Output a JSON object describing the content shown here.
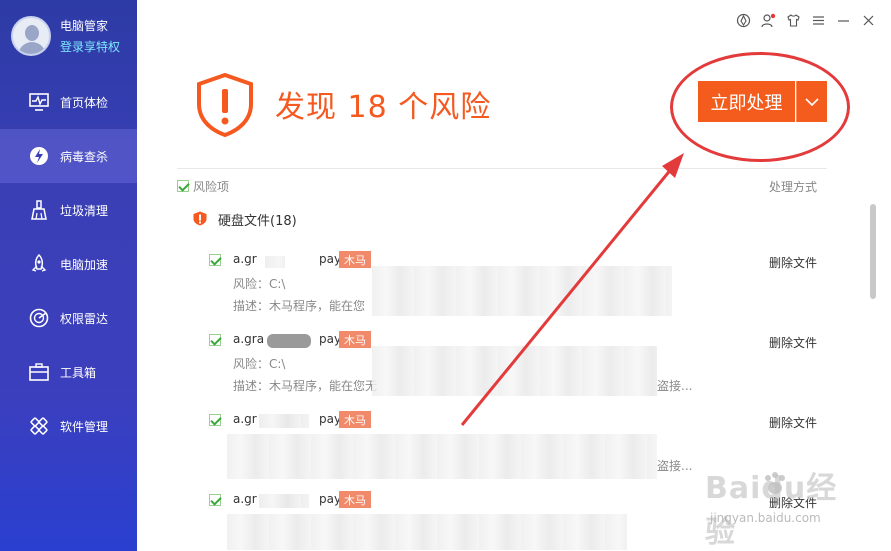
{
  "profile": {
    "name": "电脑管家",
    "login": "登录享特权"
  },
  "sidebar": {
    "items": [
      {
        "label": "首页体检",
        "icon": "monitor-icon",
        "active": false
      },
      {
        "label": "病毒查杀",
        "icon": "lightning-shield-icon",
        "active": true
      },
      {
        "label": "垃圾清理",
        "icon": "broom-icon",
        "active": false
      },
      {
        "label": "电脑加速",
        "icon": "rocket-icon",
        "active": false
      },
      {
        "label": "权限雷达",
        "icon": "radar-icon",
        "active": false
      },
      {
        "label": "工具箱",
        "icon": "toolbox-icon",
        "active": false
      },
      {
        "label": "软件管理",
        "icon": "apps-icon",
        "active": false
      }
    ]
  },
  "titlebar": {
    "icons": [
      "leaf-icon",
      "user-settings-icon",
      "shirt-icon",
      "menu-icon",
      "minimize-icon",
      "close-icon"
    ]
  },
  "header": {
    "headline": "发现 18 个风险",
    "action_label": "立即处理"
  },
  "list": {
    "col_left": "风险项",
    "col_right": "处理方式",
    "group_label": "硬盘文件(18)",
    "rows": [
      {
        "file": "a.gr",
        "suffix": "pay.s",
        "tag": "木马",
        "action": "删除文件",
        "risk": "风险：C:\\",
        "desc": "描述：木马程序，能在您"
      },
      {
        "file": "a.gra",
        "suffix": "pay.s",
        "tag": "木马",
        "action": "删除文件",
        "risk": "风险：C:\\",
        "desc": "描述：木马程序，能在您无",
        "desc_tail": "盗接..."
      },
      {
        "file": "a.gr",
        "suffix": "pay.s",
        "tag": "木马",
        "action": "删除文件",
        "risk": "",
        "desc": "",
        "desc_tail": "盗接..."
      },
      {
        "file": "a.gr",
        "suffix": "pay.s",
        "tag": "木马",
        "action": "删除文件",
        "risk": "",
        "desc": ""
      }
    ]
  },
  "watermark": {
    "brand": "Baidu经验",
    "url": "jingyan.baidu.com"
  },
  "colors": {
    "accent": "#f35c1d",
    "sidebar": "#3a3fb6",
    "annotation": "#e33b3b"
  }
}
